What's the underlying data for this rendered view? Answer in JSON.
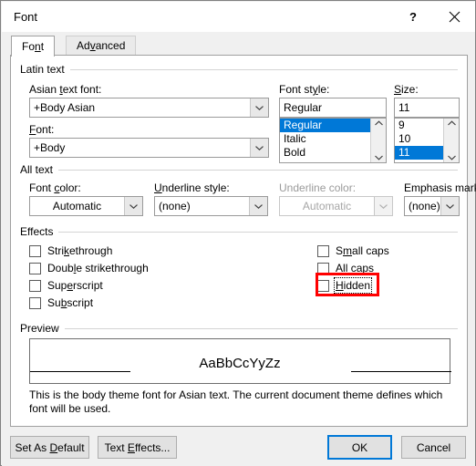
{
  "window": {
    "title": "Font",
    "help_icon": "question-mark-icon",
    "close_icon": "close-icon"
  },
  "tabs": [
    {
      "label": "Font",
      "accel_index": 2,
      "active": true
    },
    {
      "label": "Advanced",
      "accel_index": 3,
      "active": false
    }
  ],
  "groups": {
    "latin_text": {
      "label": "Latin text"
    },
    "all_text": {
      "label": "All text"
    },
    "effects": {
      "label": "Effects"
    },
    "preview": {
      "label": "Preview"
    }
  },
  "latin_text": {
    "asian_font": {
      "label_pre": "Asian ",
      "label_accel": "t",
      "label_post": "ext font:",
      "value": "+Body Asian"
    },
    "font": {
      "label_accel": "F",
      "label_post": "ont:",
      "value": "+Body"
    },
    "font_style": {
      "label_pre": "Font st",
      "label_accel": "y",
      "label_post": "le:",
      "value": "Regular",
      "options": [
        "Regular",
        "Italic",
        "Bold"
      ],
      "selected": "Regular"
    },
    "size": {
      "label_accel": "S",
      "label_post": "ize:",
      "value": "11",
      "options": [
        "9",
        "10",
        "11"
      ],
      "selected": "11"
    }
  },
  "all_text": {
    "font_color": {
      "label_pre": "Font ",
      "label_accel": "c",
      "label_post": "olor:",
      "value": "Automatic",
      "disabled": false
    },
    "underline_style": {
      "label_accel": "U",
      "label_post": "nderline style:",
      "value": "(none)",
      "disabled": false
    },
    "underline_color": {
      "label": "Underline color:",
      "value": "Automatic",
      "disabled": true
    },
    "emphasis_mark": {
      "label_pre": "Emphasis mark",
      "label_accel": ":",
      "label_post": "",
      "value": "(none)",
      "disabled": false
    }
  },
  "effects": {
    "left": [
      {
        "label_pre": "Stri",
        "accel": "k",
        "label_post": "ethrough",
        "checked": false
      },
      {
        "label_pre": "Doub",
        "accel": "l",
        "label_post": "e strikethrough",
        "checked": false
      },
      {
        "label_pre": "Sup",
        "accel": "e",
        "label_post": "rscript",
        "checked": false
      },
      {
        "label_pre": "Su",
        "accel": "b",
        "label_post": "script",
        "checked": false
      }
    ],
    "right": [
      {
        "label_pre": "S",
        "accel": "m",
        "label_post": "all caps",
        "checked": false,
        "focused": false
      },
      {
        "label_pre": "A",
        "accel": "l",
        "label_post": "l caps",
        "checked": false,
        "focused": false
      },
      {
        "label_pre": "",
        "accel": "H",
        "label_post": "idden",
        "checked": false,
        "focused": true
      }
    ]
  },
  "preview": {
    "sample_text": "AaBbCcYyZz",
    "note": "This is the body theme font for Asian text. The current document theme defines which font will be used."
  },
  "footer": {
    "set_as_default": {
      "label_pre": "Set As ",
      "accel": "D",
      "label_post": "efault"
    },
    "text_effects": {
      "label_pre": "Text ",
      "accel": "E",
      "label_post": "ffects..."
    },
    "ok": "OK",
    "cancel": "Cancel"
  },
  "annotation": {
    "target": "Hidden",
    "color": "#ff0000"
  },
  "colors": {
    "accent": "#0078d7",
    "dialog_bg": "#f0f0f0",
    "panel_bg": "#ffffff",
    "border": "#a0a0a0",
    "disabled_text": "#a6a6a6",
    "annotation": "#ff0000"
  }
}
